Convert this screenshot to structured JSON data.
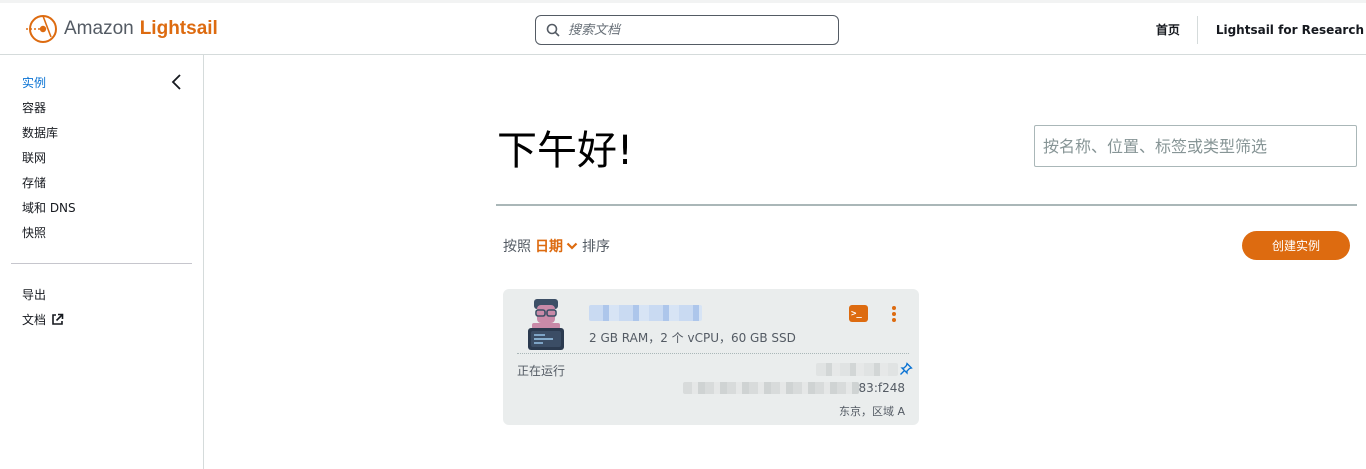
{
  "header": {
    "brand_prefix": "Amazon",
    "brand_product": "Lightsail",
    "search_placeholder": "搜索文档",
    "nav_home": "首页",
    "nav_research": "Lightsail for Research"
  },
  "sidebar": {
    "items": [
      {
        "label": "实例",
        "active": true
      },
      {
        "label": "容器"
      },
      {
        "label": "数据库"
      },
      {
        "label": "联网"
      },
      {
        "label": "存储"
      },
      {
        "label": "域和 DNS"
      },
      {
        "label": "快照"
      }
    ],
    "secondary": [
      {
        "label": "导出"
      },
      {
        "label": "文档",
        "icon": "external-link-icon"
      }
    ]
  },
  "main": {
    "greeting": "下午好!",
    "filter_placeholder": "按名称、位置、标签或类型筛选",
    "sort_prefix": "按照",
    "sort_value": "日期",
    "sort_suffix": "排序",
    "create_button": "创建实例",
    "instance": {
      "name": "",
      "specs": "2 GB RAM，2 个 vCPU，60 GB SSD",
      "status": "正在运行",
      "ipv6_tail": "83:f248",
      "zone": "东京，区域 A"
    }
  },
  "colors": {
    "accent": "#dd6b10",
    "link_active": "#0972d3",
    "card_bg": "#eaeded"
  }
}
